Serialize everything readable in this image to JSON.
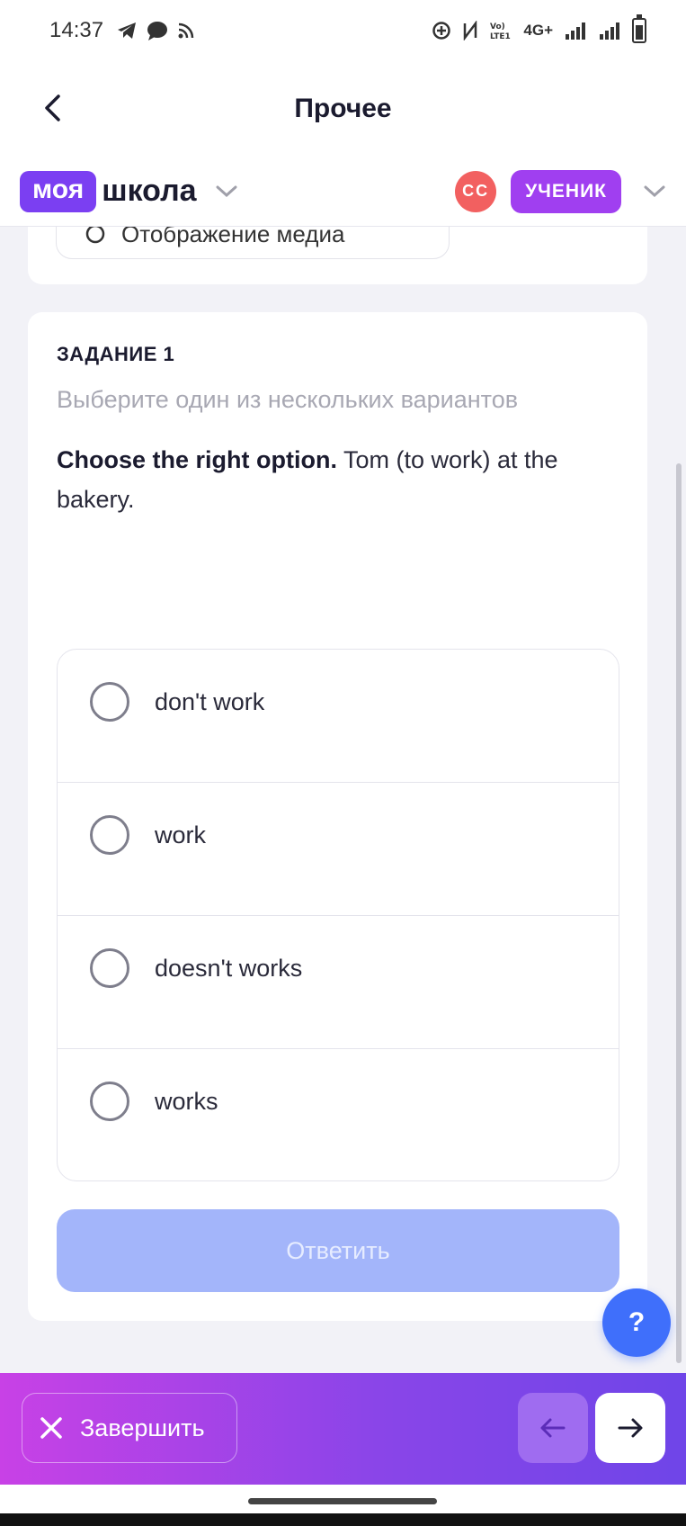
{
  "status_bar": {
    "time": "14:37",
    "network": "4G+"
  },
  "nav": {
    "title": "Прочее"
  },
  "brand": {
    "logo_part1": "моя",
    "logo_part2": "школа",
    "avatar_initials": "СС",
    "role": "УЧЕНИК"
  },
  "prev_card": {
    "button_label": "Отображение медиа"
  },
  "task": {
    "number": "ЗАДАНИЕ 1",
    "instruction": "Выберите один из нескольких вариантов",
    "question_bold": "Choose the right option.",
    "question_text": " Tom (to work) at the bakery.",
    "options": [
      "don't work",
      "work",
      "doesn't works",
      "works"
    ],
    "submit_label": "Ответить"
  },
  "help": {
    "label": "?"
  },
  "bottom_bar": {
    "finish_label": "Завершить"
  },
  "colors": {
    "brand_purple": "#7B3FF2",
    "role_badge": "#A03FF0",
    "avatar": "#F26060",
    "submit_disabled": "#A3B5FA",
    "help": "#3F6FFB"
  }
}
